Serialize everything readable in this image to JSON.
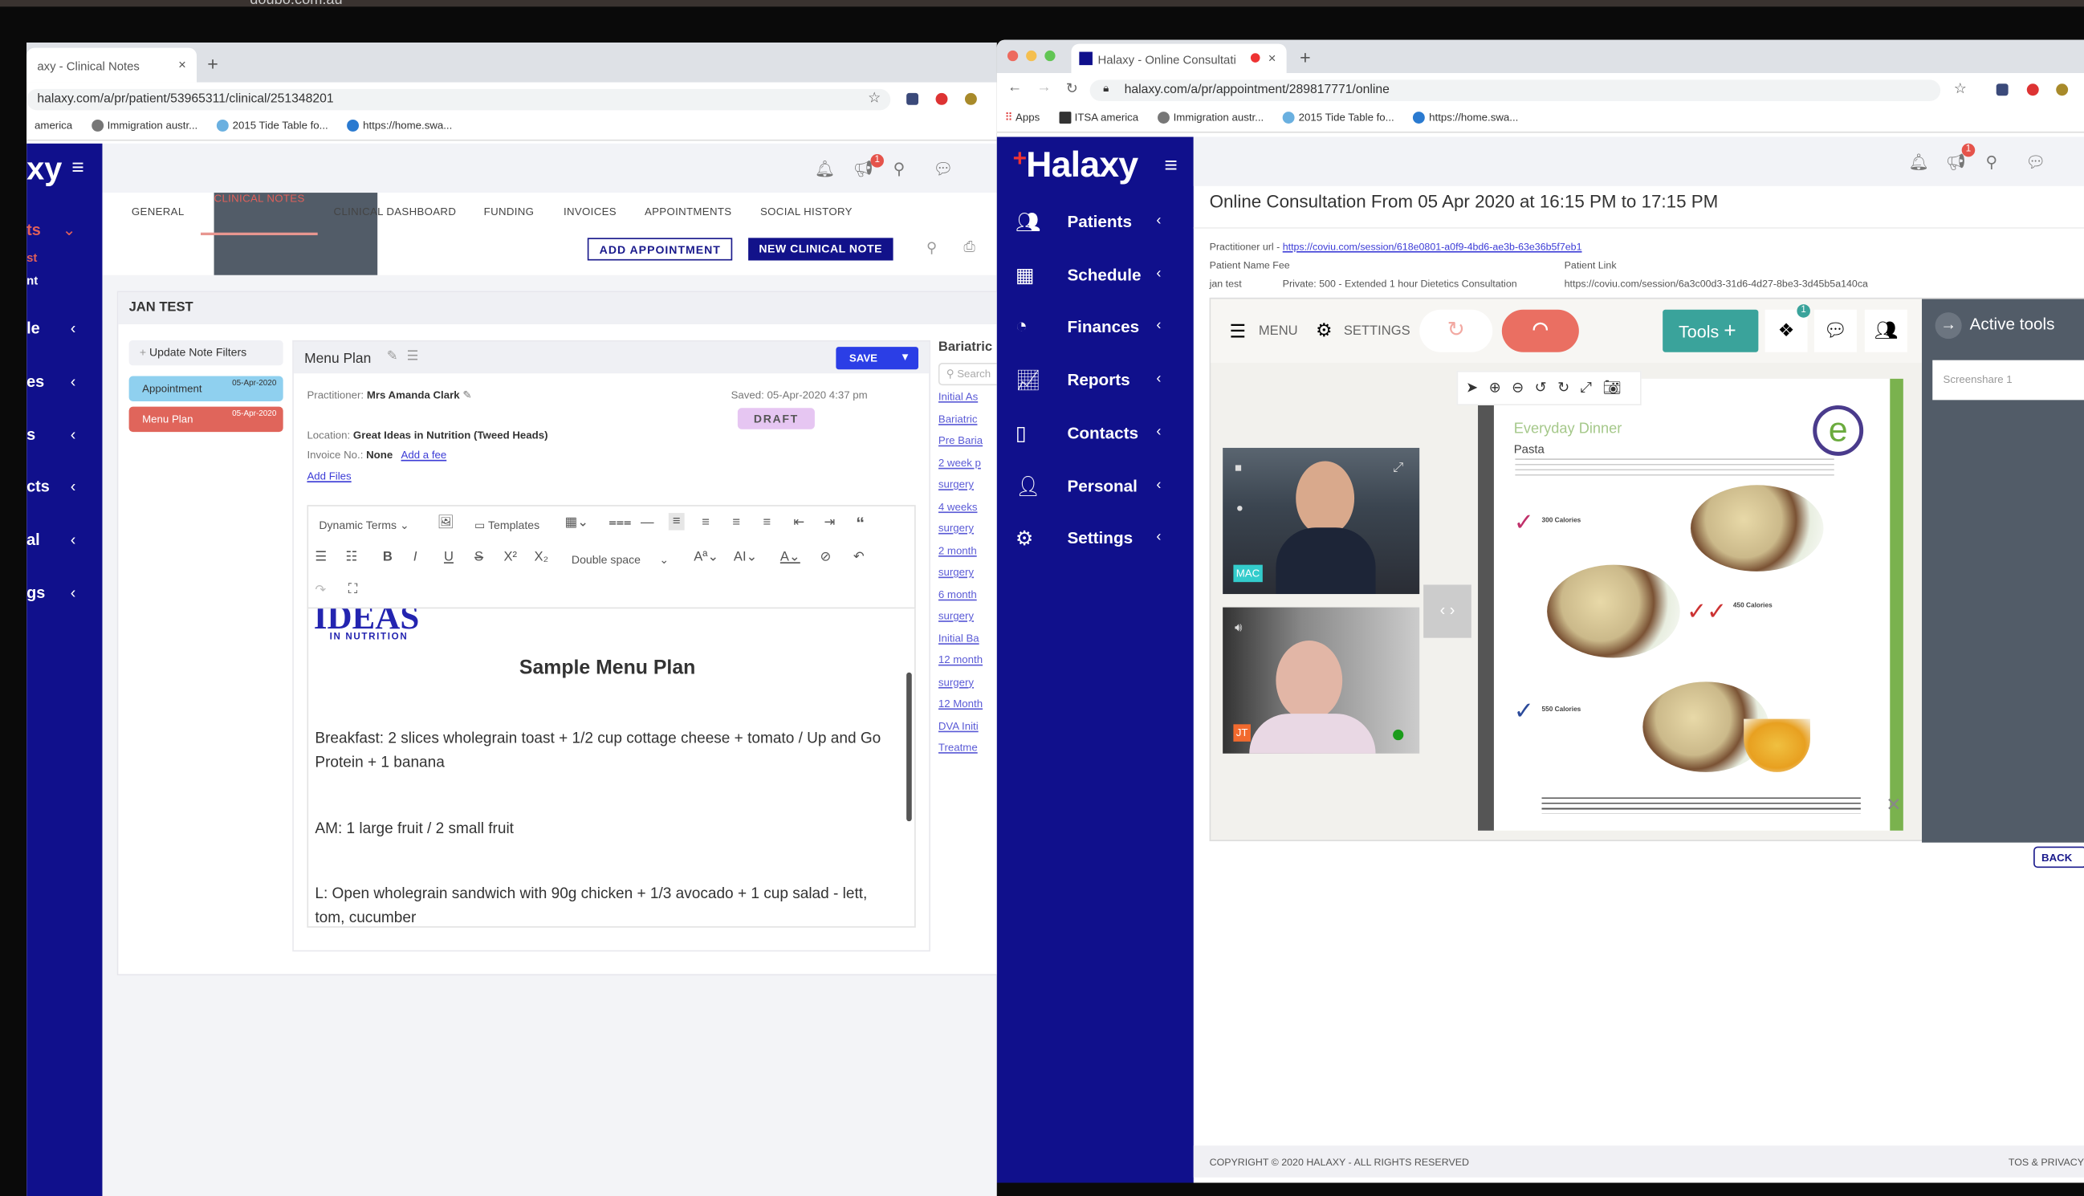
{
  "top": {
    "overlay_text": "doubo.com.au"
  },
  "left_window": {
    "tab_title": "axy - Clinical Notes",
    "url": "halaxy.com/a/pr/patient/53965311/clinical/251348201",
    "bookmarks": [
      "america",
      "Immigration austr...",
      "2015 Tide Table fo...",
      "https://home.swa..."
    ],
    "logo_partial": "xy",
    "notification_count": "1",
    "sidebar_items": [
      {
        "label": "ts",
        "chevron": "⌄"
      },
      {
        "label": "st",
        "chevron": ""
      },
      {
        "label": "nt",
        "chevron": ""
      },
      {
        "label": "le",
        "chevron": "‹"
      },
      {
        "label": "es",
        "chevron": "‹"
      },
      {
        "label": "s",
        "chevron": "‹"
      },
      {
        "label": "cts",
        "chevron": "‹"
      },
      {
        "label": "al",
        "chevron": "‹"
      },
      {
        "label": "gs",
        "chevron": "‹"
      }
    ],
    "tabs": [
      "GENERAL",
      "CLINICAL NOTES",
      "CLINICAL DASHBOARD",
      "FUNDING",
      "INVOICES",
      "APPOINTMENTS",
      "SOCIAL HISTORY"
    ],
    "active_tab": "CLINICAL NOTES",
    "add_appointment": "ADD APPOINTMENT",
    "new_clinical_note": "NEW CLINICAL NOTE",
    "patient_name": "JAN TEST",
    "update_filters": "Update Note Filters",
    "notes": [
      {
        "label": "Appointment",
        "date": "05-Apr-2020",
        "color": "#8fd0ef"
      },
      {
        "label": "Menu Plan",
        "date": "05-Apr-2020",
        "color": "#e0655b"
      }
    ],
    "editor": {
      "title": "Menu Plan",
      "save": "SAVE",
      "practitioner_label": "Practitioner:",
      "practitioner": "Mrs Amanda Clark",
      "saved": "Saved: 05-Apr-2020 4:37 pm",
      "status": "DRAFT",
      "location_label": "Location:",
      "location": "Great Ideas in Nutrition (Tweed Heads)",
      "invoice_label": "Invoice No.:",
      "invoice": "None",
      "add_fee": "Add a fee",
      "add_files": "Add Files",
      "toolbar": {
        "dynamic_terms": "Dynamic Terms",
        "templates": "Templates",
        "line_spacing": "Double space"
      },
      "logo_text": "IDEAS",
      "logo_sub": "IN NUTRITION",
      "heading": "Sample Menu Plan",
      "paragraphs": [
        "Breakfast: 2 slices wholegrain toast + 1/2 cup cottage cheese + tomato / Up and Go Protein + 1 banana",
        "AM: 1 large fruit / 2 small fruit",
        "L: Open wholegrain sandwich with 90g chicken + 1/3 avocado + 1 cup salad - lett, tom, cucumber"
      ]
    },
    "bariatric": {
      "heading": "Bariatric",
      "search_placeholder": "Search",
      "links": [
        "Initial As",
        "Bariatric",
        "Pre Baria",
        "2 week p",
        "surgery",
        "4 weeks",
        "surgery",
        "2 month",
        "surgery",
        "6 month",
        "surgery",
        "Initial Ba",
        "12 month",
        "surgery",
        "12 Month",
        "DVA Initi",
        "Treatme"
      ]
    }
  },
  "right_window": {
    "tab_title": "Halaxy - Online Consultati",
    "url": "halaxy.com/a/pr/appointment/289817771/online",
    "bookmarks": [
      "Apps",
      "ITSA america",
      "Immigration austr...",
      "2015 Tide Table fo...",
      "https://home.swa..."
    ],
    "logo": "Halaxy",
    "notification_count": "1",
    "nav": [
      {
        "label": "Patients",
        "icon": "users-icon"
      },
      {
        "label": "Schedule",
        "icon": "calendar-icon"
      },
      {
        "label": "Finances",
        "icon": "pie-chart-icon"
      },
      {
        "label": "Reports",
        "icon": "line-chart-icon"
      },
      {
        "label": "Contacts",
        "icon": "address-book-icon"
      },
      {
        "label": "Personal",
        "icon": "user-icon"
      },
      {
        "label": "Settings",
        "icon": "gear-icon"
      }
    ],
    "title": "Online Consultation From 05 Apr 2020 at 16:15 PM to 17:15 PM",
    "practitioner_url_label": "Practitioner url -",
    "practitioner_url": "https://coviu.com/session/618e0801-a0f9-4bd6-ae3b-63e36b5f7eb1",
    "patient_name_fee_label": "Patient Name Fee",
    "patient_link_label": "Patient Link",
    "patient_name": "jan test",
    "fee": "Private: 500 - Extended 1 hour Dietetics Consultation",
    "patient_link": "https://coviu.com/session/6a3c00d3-31d6-4d27-8be3-3d45b5a140ca",
    "call": {
      "menu": "MENU",
      "settings": "SETTINGS",
      "tools": "Tools",
      "layers_badge": "1",
      "active_tools": "Active tools",
      "screenshare": "Screenshare 1",
      "participant_tags": [
        "MAC",
        "JT"
      ],
      "doc_title": "Everyday Dinner",
      "doc_subtitle": "Pasta",
      "doc_options": [
        "300 Calories",
        "450 Calories",
        "550 Calories"
      ]
    },
    "back": "BACK",
    "footer": {
      "copyright": "COPYRIGHT © 2020 HALAXY - ALL RIGHTS RESERVED",
      "links": "TOS & PRIVACY"
    }
  }
}
